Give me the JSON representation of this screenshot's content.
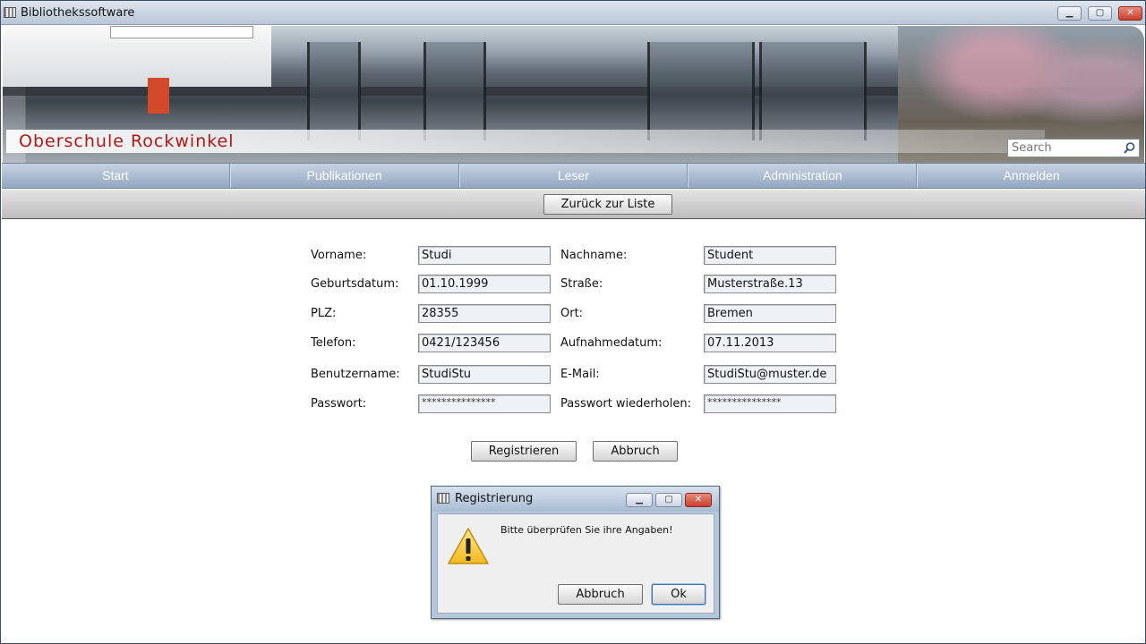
{
  "window": {
    "title": "Bibliothekssoftware",
    "controls": {
      "minimize": "▁",
      "maximize": "▢",
      "close": "✕"
    }
  },
  "banner": {
    "school_name": "Oberschule Rockwinkel",
    "search_placeholder": "Search"
  },
  "nav": {
    "items": [
      "Start",
      "Publikationen",
      "Leser",
      "Administration",
      "Anmelden"
    ]
  },
  "toolbar": {
    "back_label": "Zurück zur Liste"
  },
  "form": {
    "fields": [
      {
        "label": "Vorname:",
        "value": "Studi"
      },
      {
        "label": "Nachname:",
        "value": "Student"
      },
      {
        "label": "Geburtsdatum:",
        "value": "01.10.1999"
      },
      {
        "label": "Straße:",
        "value": "Musterstraße.13"
      },
      {
        "label": "PLZ:",
        "value": "28355"
      },
      {
        "label": "Ort:",
        "value": "Bremen"
      },
      {
        "label": "Telefon:",
        "value": "0421/123456"
      },
      {
        "label": "Aufnahmedatum:",
        "value": "07.11.2013"
      },
      {
        "label": "Benutzername:",
        "value": "StudiStu"
      },
      {
        "label": "E-Mail:",
        "value": "StudiStu@muster.de"
      },
      {
        "label": "Passwort:",
        "value": "***************"
      },
      {
        "label": "Passwort wiederholen:",
        "value": "***************"
      }
    ],
    "register_label": "Registrieren",
    "cancel_label": "Abbruch"
  },
  "dialog": {
    "title": "Registrierung",
    "message": "Bitte überprüfen Sie ihre Angaben!",
    "cancel_label": "Abbruch",
    "ok_label": "Ok",
    "icon": "warning-icon"
  },
  "colors": {
    "nav_bg": "#a9bbd2",
    "school_name": "#b01818",
    "dialog_frame": "#b7c8dc"
  }
}
